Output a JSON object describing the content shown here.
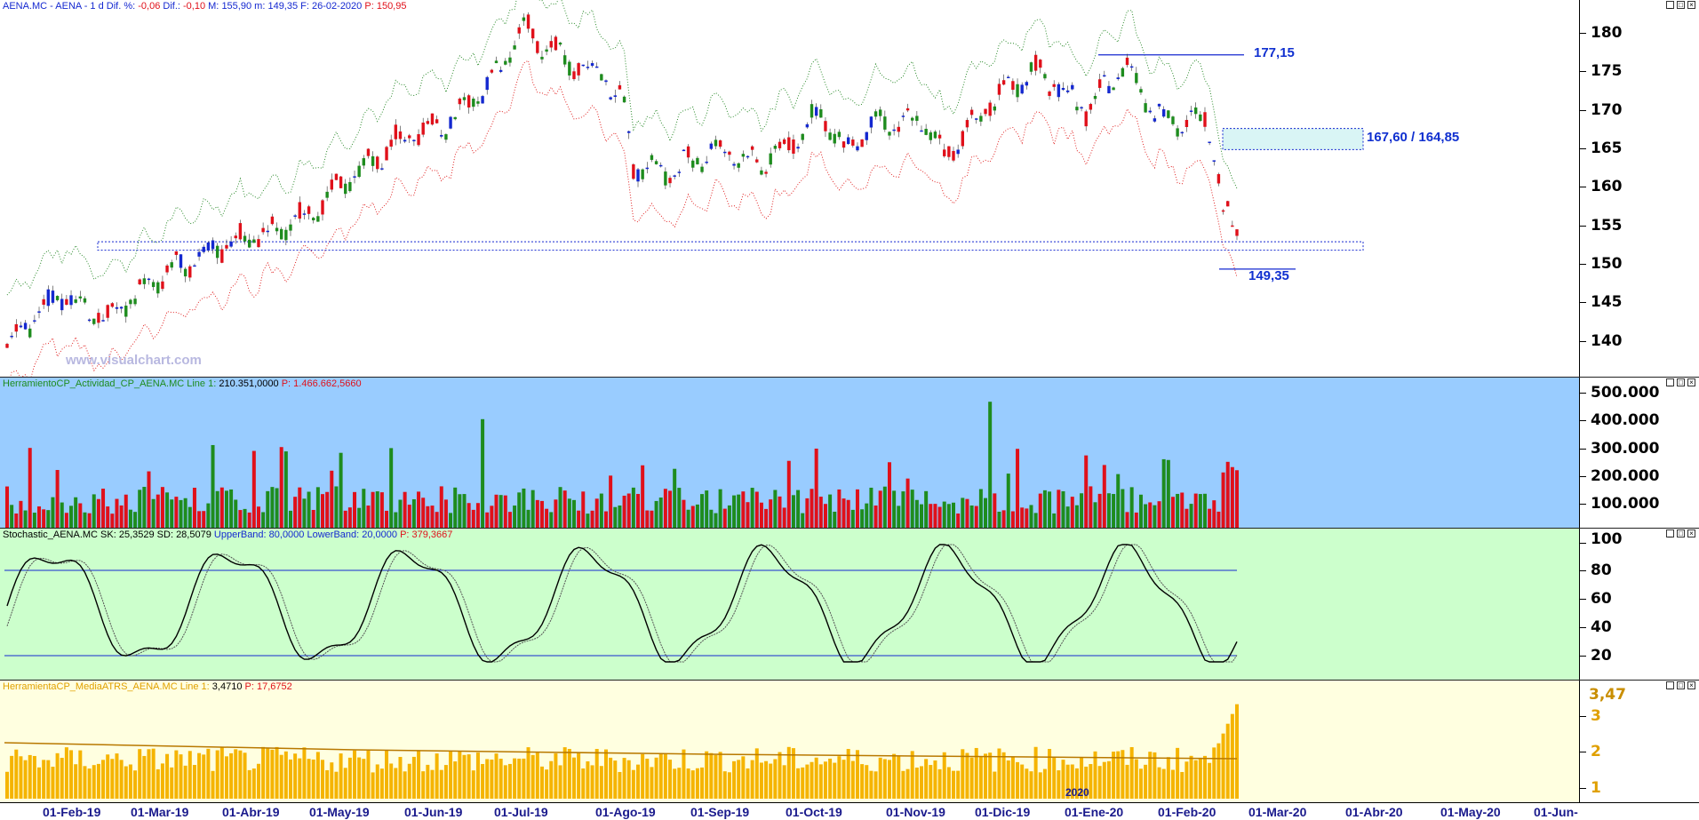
{
  "price_pane": {
    "title_parts": {
      "symbol": "AENA.MC - AENA - 1 d",
      "dif_pct_label": "Dif. %:",
      "dif_pct": "-0,06",
      "dif_label": "Dif.:",
      "dif": "-0,10",
      "max_label": "M:",
      "max": "155,90",
      "min_label": "m:",
      "min": "149,35",
      "date_label": "F:",
      "date": "26-02-2020",
      "p_label": "P:",
      "p": "150,95"
    },
    "watermark": "www.visualchart.com",
    "y_labels": [
      "180",
      "175",
      "170",
      "165",
      "160",
      "155",
      "150",
      "145",
      "140"
    ],
    "annotations": {
      "resistance": "177,15",
      "gap_zone": "167,60 / 164,85",
      "low": "149,35"
    }
  },
  "activity_pane": {
    "title": "HerramientoCP_Actividad_CP_AENA.MC",
    "line_label": "Line 1:",
    "line_value": "210.351,0000",
    "p_label": "P:",
    "p_value": "1.466.662,5660",
    "y_labels": [
      "500.000",
      "400.000",
      "300.000",
      "200.000",
      "100.000"
    ]
  },
  "stoch_pane": {
    "title": "Stochastic_AENA.MC",
    "sk": "SK: 25,3529",
    "sd": "SD: 28,5079",
    "upper": "UpperBand: 80,0000",
    "lower": "LowerBand: 20,0000",
    "p": "P: 379,3667",
    "y_labels": [
      "100",
      "80",
      "60",
      "40",
      "20"
    ]
  },
  "atr_pane": {
    "title": "HerramientaCP_MediaATRS_AENA.MC",
    "line_label": "Line 1:",
    "line_value": "3,4710",
    "p_label": "P:",
    "p_value": "17,6752",
    "y_labels": [
      "3",
      "2",
      "1"
    ],
    "last_value": "3,47",
    "year_marker": "2020"
  },
  "x_axis_labels": [
    "01-Feb-19",
    "01-Mar-19",
    "01-Abr-19",
    "01-May-19",
    "01-Jun-19",
    "01-Jul-19",
    "01-Ago-19",
    "01-Sep-19",
    "01-Oct-19",
    "01-Nov-19",
    "01-Dic-19",
    "01-Ene-20",
    "01-Feb-20",
    "01-Mar-20",
    "01-Abr-20",
    "01-May-20",
    "01-Jun-"
  ],
  "colors": {
    "price_bg": "#ffffff",
    "activity_bg": "#99ccff",
    "stoch_bg": "#ccffcc",
    "atr_bg": "#ffffe0",
    "bull": "#1e8c1e",
    "bear": "#e0101a",
    "neutral": "#1428d0",
    "atr_bar": "#f5b400",
    "annotation": "#1030d0"
  }
}
